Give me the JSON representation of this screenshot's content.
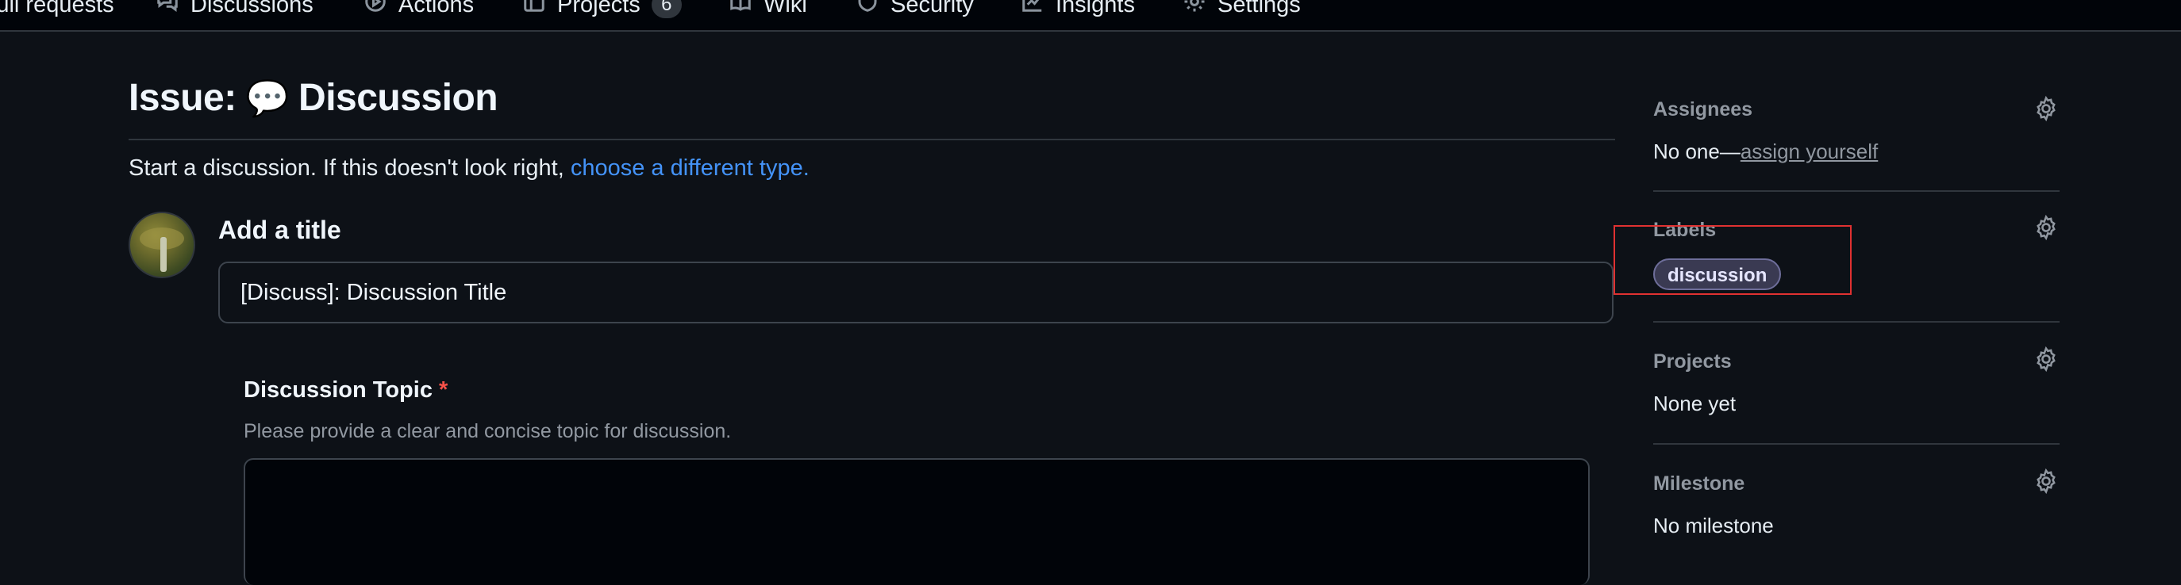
{
  "topnav": {
    "tabs": [
      {
        "label": "Pull requests",
        "icon": "pull-request-icon"
      },
      {
        "label": "Discussions",
        "icon": "discussions-icon"
      },
      {
        "label": "Actions",
        "icon": "actions-icon"
      },
      {
        "label": "Projects",
        "icon": "projects-icon",
        "count": "6"
      },
      {
        "label": "Wiki",
        "icon": "wiki-icon"
      },
      {
        "label": "Security",
        "icon": "shield-icon"
      },
      {
        "label": "Insights",
        "icon": "graph-icon"
      },
      {
        "label": "Settings",
        "icon": "gear-icon"
      }
    ]
  },
  "page": {
    "title_prefix": "Issue:",
    "title_emoji": "💬",
    "title_name": "Discussion",
    "intro_text": "Start a discussion. If this doesn't look right,",
    "intro_link": "choose a different type."
  },
  "form": {
    "add_title_label": "Add a title",
    "title_value": "[Discuss]: Discussion Title",
    "topic_label": "Discussion Topic",
    "topic_required_marker": "*",
    "topic_help": "Please provide a clear and concise topic for discussion."
  },
  "sidebar": {
    "assignees": {
      "title": "Assignees",
      "value_prefix": "No one—",
      "value_link": "assign yourself"
    },
    "labels": {
      "title": "Labels",
      "items": [
        "discussion"
      ]
    },
    "projects": {
      "title": "Projects",
      "value": "None yet"
    },
    "milestone": {
      "title": "Milestone",
      "value": "No milestone"
    }
  },
  "colors": {
    "background": "#0d1117",
    "link": "#4493f8",
    "required": "#f85149",
    "highlight": "#e03131"
  }
}
